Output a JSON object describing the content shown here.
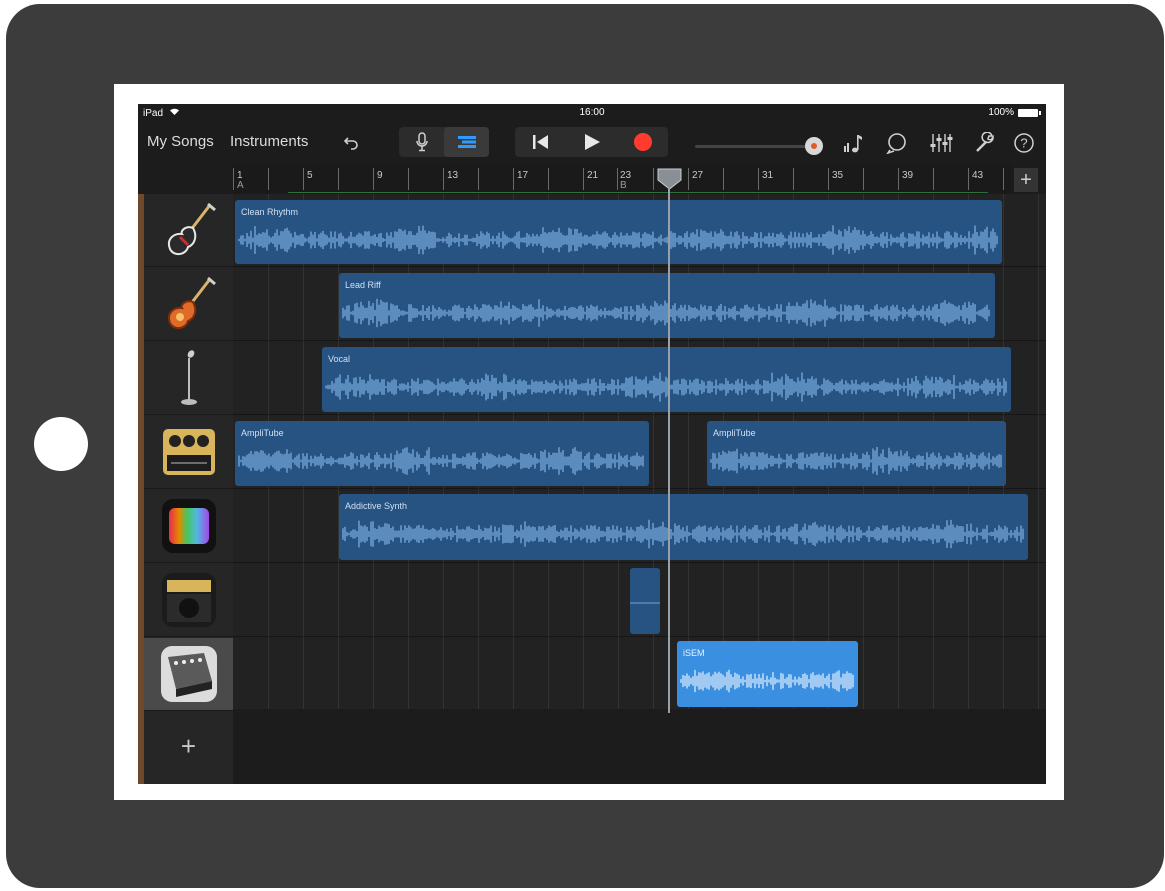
{
  "status": {
    "device": "iPad",
    "time": "16:00",
    "battery": "100%"
  },
  "toolbar": {
    "my_songs": "My Songs",
    "instruments": "Instruments",
    "icons": [
      "undo-icon",
      "microphone-icon",
      "tracks-view-icon",
      "go-to-start-icon",
      "play-icon",
      "record-icon",
      "master-volume-slider",
      "metronome-icon",
      "loop-icon",
      "mixer-icon",
      "settings-icon",
      "help-icon"
    ],
    "colors": {
      "record": "#ff3b30",
      "active_view": "#2f9bff"
    }
  },
  "ruler": {
    "bars": [
      "1",
      "5",
      "9",
      "13",
      "17",
      "21",
      "23",
      "27",
      "31",
      "35",
      "39",
      "43"
    ],
    "sections": [
      "A",
      "B"
    ]
  },
  "tracks": [
    {
      "instrument": "electric-guitar-icon",
      "regions": [
        {
          "name": "Clean Rhythm"
        }
      ]
    },
    {
      "instrument": "sunburst-guitar-icon",
      "regions": [
        {
          "name": "Lead Riff"
        }
      ]
    },
    {
      "instrument": "microphone-stand-icon",
      "regions": [
        {
          "name": "Vocal"
        }
      ]
    },
    {
      "instrument": "pedal-icon",
      "regions": [
        {
          "name": "AmpliTube"
        },
        {
          "name": "AmpliTube"
        }
      ]
    },
    {
      "instrument": "synth-app-icon",
      "regions": [
        {
          "name": "Addictive Synth"
        }
      ]
    },
    {
      "instrument": "amp-app-icon",
      "regions": [
        {
          "name": ""
        }
      ]
    },
    {
      "instrument": "isem-synth-icon",
      "regions": [
        {
          "name": "iSEM"
        }
      ]
    }
  ],
  "add_track": "+"
}
